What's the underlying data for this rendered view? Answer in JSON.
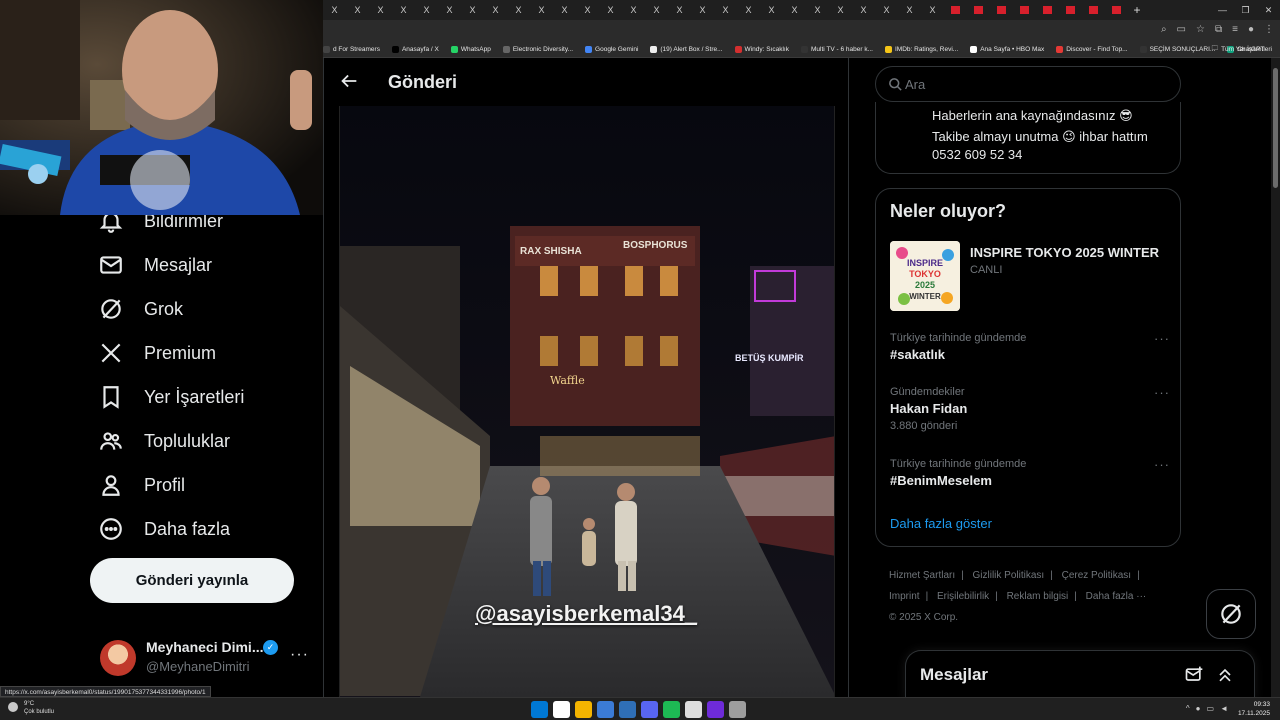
{
  "browser": {
    "tabstrip_glyph": "X",
    "new_tab": "+",
    "bookmarks": [
      {
        "label": "d For Streamers",
        "color": "#444444"
      },
      {
        "label": "Anasayfa / X",
        "color": "#000000"
      },
      {
        "label": "WhatsApp",
        "color": "#25d366"
      },
      {
        "label": "Electronic Diversity...",
        "color": "#666666"
      },
      {
        "label": "Google Gemini",
        "color": "#4285f4"
      },
      {
        "label": "(19) Alert Box / Stre...",
        "color": "#eeeeee"
      },
      {
        "label": "Windy: Sıcaklık",
        "color": "#d32f2f"
      },
      {
        "label": "Multi TV - 6 haber k...",
        "color": "#333333"
      },
      {
        "label": "IMDb: Ratings, Revi...",
        "color": "#f5c518"
      },
      {
        "label": "Ana Sayfa • HBO Max",
        "color": "#ffffff"
      },
      {
        "label": "Discover - Find Top...",
        "color": "#e53935"
      },
      {
        "label": "SEÇİM SONUÇLARI...",
        "color": "#333333"
      },
      {
        "label": "ChatGPT",
        "color": "#10a37f"
      }
    ],
    "all_bookmarks": "Tüm Yer İşaretleri",
    "status_url": "https://x.com/asayisberkemal0/status/1990175377344331996/photo/1"
  },
  "sidebar": {
    "items": [
      {
        "label": "Bildirimler",
        "icon": "bell-icon"
      },
      {
        "label": "Mesajlar",
        "icon": "envelope-icon"
      },
      {
        "label": "Grok",
        "icon": "grok-icon"
      },
      {
        "label": "Premium",
        "icon": "x-logo-icon"
      },
      {
        "label": "Yer İşaretleri",
        "icon": "bookmark-icon"
      },
      {
        "label": "Topluluklar",
        "icon": "people-icon"
      },
      {
        "label": "Profil",
        "icon": "person-icon"
      },
      {
        "label": "Daha fazla",
        "icon": "more-circle-icon"
      }
    ],
    "post_button": "Gönderi yayınla",
    "account": {
      "name": "Meyhaneci Dimi...",
      "handle": "@MeyhaneDimitri",
      "more": "···"
    }
  },
  "main": {
    "title": "Gönderi",
    "photo_watermark": "@asayisberkemal34_"
  },
  "right": {
    "search_placeholder": "Ara",
    "bio_lines": [
      "Haberlerin ana kaynağındasınız 😎",
      "Takibe almayı unutma 😉 ihbar hattım",
      "0532 609 52 34"
    ],
    "trends_title": "Neler oluyor?",
    "featured": {
      "title": "INSPIRE TOKYO 2025 WINTER",
      "status": "CANLI"
    },
    "trends": [
      {
        "context": "Türkiye tarihinde gündemde",
        "title": "#sakatlık",
        "count": ""
      },
      {
        "context": "Gündemdekiler",
        "title": "Hakan Fidan",
        "count": "3.880 gönderi"
      },
      {
        "context": "Türkiye tarihinde gündemde",
        "title": "#BenimMeselem",
        "count": ""
      }
    ],
    "more_dots": "···",
    "show_more": "Daha fazla göster",
    "footer": {
      "row1": [
        "Hizmet Şartları",
        "|",
        "Gizlilik Politikası",
        "|",
        "Çerez Politikası",
        "|"
      ],
      "row2": [
        "Imprint",
        "|",
        "Erişilebilirlik",
        "|",
        "Reklam bilgisi",
        "|",
        "Daha fazla ···"
      ],
      "row3": [
        "© 2025 X Corp."
      ]
    },
    "messages_drawer": "Mesajlar"
  },
  "taskbar": {
    "temp": "9°C",
    "weather": "Çok bulutlu",
    "time": "09:33",
    "date": "17.11.2025",
    "app_colors": [
      "#0078d4",
      "#ffffff",
      "#f4b400",
      "#3b7bd6",
      "#2f6fb7",
      "#5865f2",
      "#1db954",
      "#dddddd",
      "#6e2bd9",
      "#9e9e9e"
    ]
  }
}
